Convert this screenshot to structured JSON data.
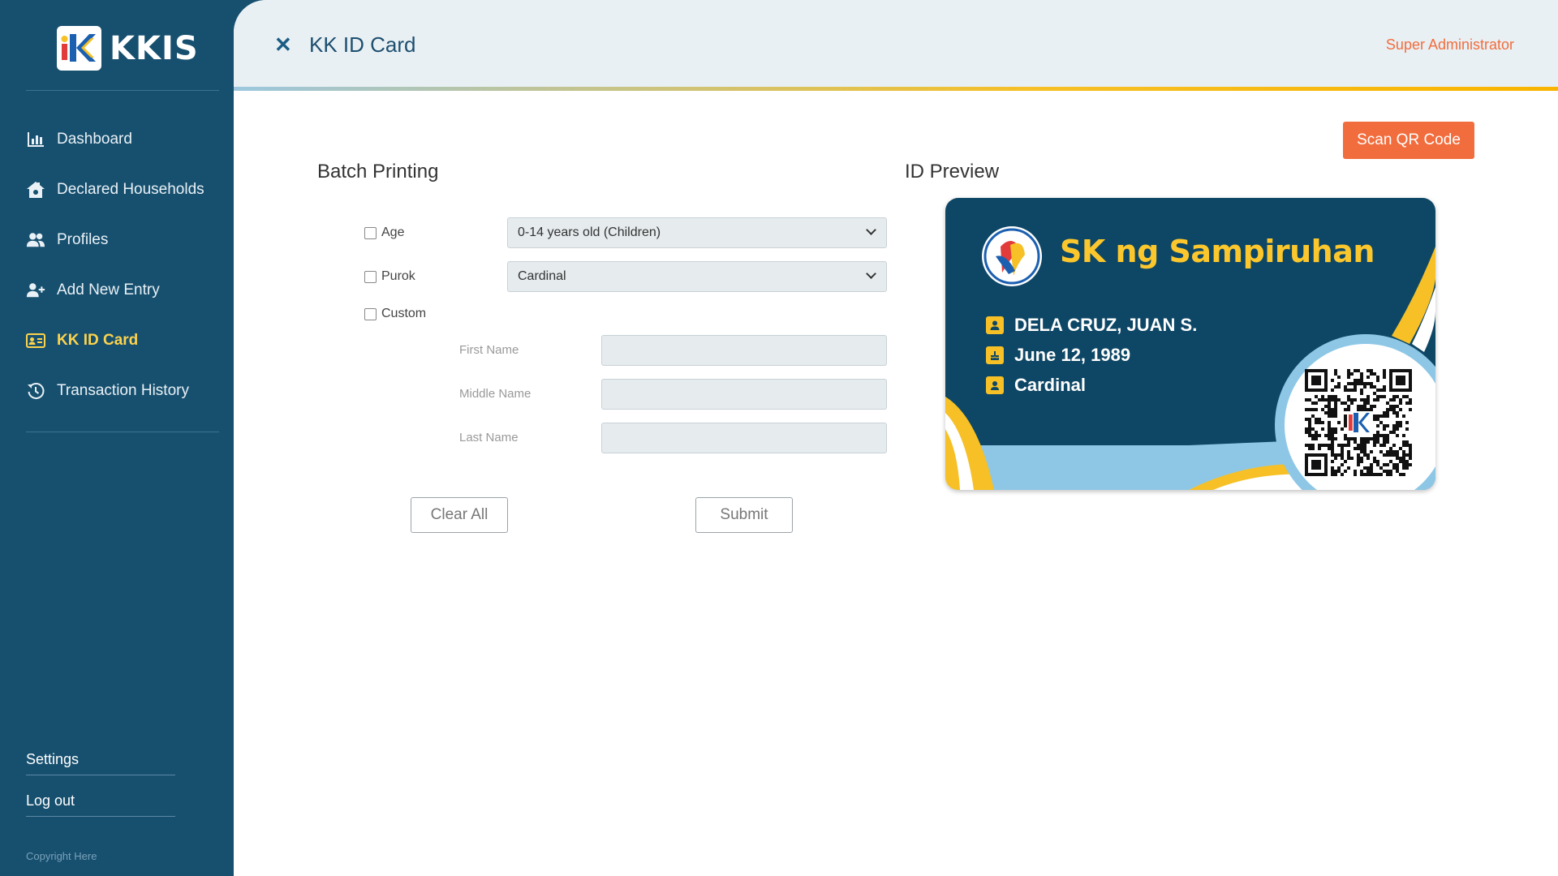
{
  "app": {
    "logo_text": "KKIS"
  },
  "sidebar": {
    "items": [
      {
        "label": "Dashboard",
        "icon": "chart-icon",
        "active": false
      },
      {
        "label": "Declared Households",
        "icon": "house-icon",
        "active": false
      },
      {
        "label": "Profiles",
        "icon": "users-icon",
        "active": false
      },
      {
        "label": "Add New Entry",
        "icon": "user-plus-icon",
        "active": false
      },
      {
        "label": "KK ID Card",
        "icon": "id-card-icon",
        "active": true
      },
      {
        "label": "Transaction History",
        "icon": "history-icon",
        "active": false
      }
    ],
    "settings_label": "Settings",
    "logout_label": "Log out",
    "copyright": "Copyright Here"
  },
  "header": {
    "title": "KK ID Card",
    "role": "Super Administrator"
  },
  "actions": {
    "scan_label": "Scan QR Code"
  },
  "batch": {
    "title": "Batch Printing",
    "age_label": "Age",
    "age_value": "0-14 years old (Children)",
    "purok_label": "Purok",
    "purok_value": "Cardinal",
    "custom_label": "Custom",
    "first_name_label": "First Name",
    "middle_name_label": "Middle Name",
    "last_name_label": "Last Name",
    "first_name_value": "",
    "middle_name_value": "",
    "last_name_value": "",
    "clear_label": "Clear All",
    "submit_label": "Submit"
  },
  "preview": {
    "title": "ID Preview",
    "card_title": "SK ng Sampiruhan",
    "name": "DELA CRUZ, JUAN S.",
    "birthday": "June 12, 1989",
    "purok": "Cardinal"
  },
  "colors": {
    "sidebar_bg": "#17506f",
    "accent_orange": "#f26d3d",
    "accent_yellow": "#fcc72c",
    "card_bg": "#0e4766",
    "active_nav": "#fcd34d"
  }
}
